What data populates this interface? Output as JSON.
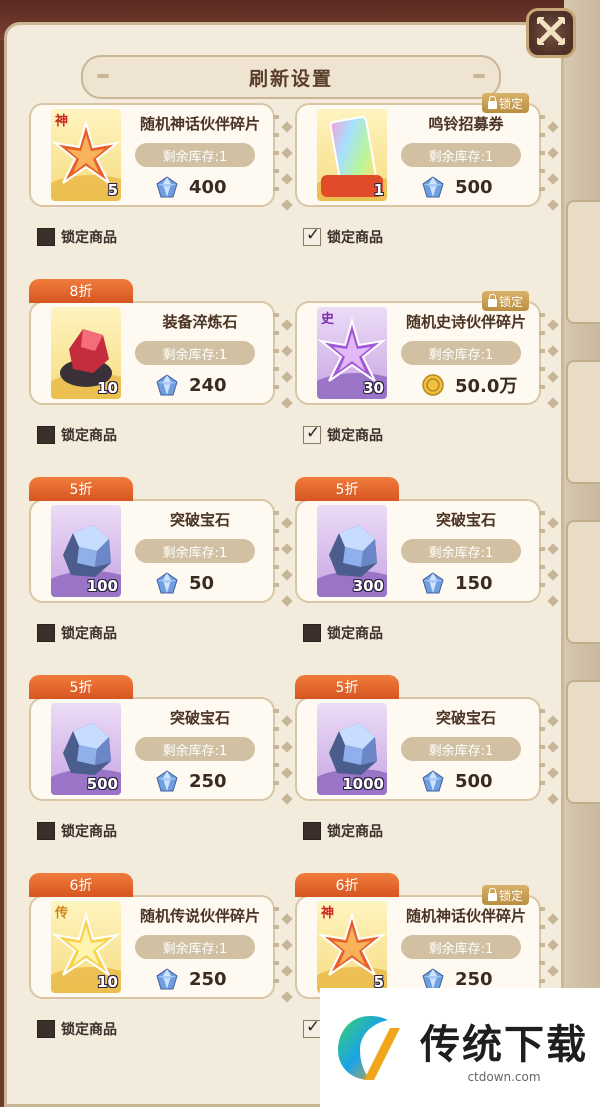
{
  "dialog": {
    "title": "刷新设置"
  },
  "lock_label": "锁定商品",
  "lock_tag": "锁定",
  "stock_prefix": "剩余库存:",
  "cards": [
    {
      "name": "随机神话伙伴碎片",
      "count": "5",
      "stock": "剩余库存:1",
      "price": "400",
      "currency": "gem",
      "discount": "",
      "locked_tag": false,
      "locked": false,
      "art": "mythic-star-shard",
      "frame": "gold"
    },
    {
      "name": "鸣铃招募券",
      "count": "1",
      "stock": "剩余库存:1",
      "price": "500",
      "currency": "gem",
      "discount": "",
      "locked_tag": true,
      "locked": true,
      "art": "rainbow-ticket",
      "frame": "gold"
    },
    {
      "name": "装备淬炼石",
      "count": "10",
      "stock": "剩余库存:1",
      "price": "240",
      "currency": "gem",
      "discount": "8折",
      "locked_tag": false,
      "locked": false,
      "art": "red-ore",
      "frame": "gold"
    },
    {
      "name": "随机史诗伙伴碎片",
      "count": "30",
      "stock": "剩余库存:1",
      "price": "50.0万",
      "currency": "coin",
      "discount": "",
      "locked_tag": true,
      "locked": true,
      "art": "epic-star-shard",
      "frame": "purple"
    },
    {
      "name": "突破宝石",
      "count": "100",
      "stock": "剩余库存:1",
      "price": "50",
      "currency": "gem",
      "discount": "5折",
      "locked_tag": false,
      "locked": false,
      "art": "breakthrough-gem",
      "frame": "purple"
    },
    {
      "name": "突破宝石",
      "count": "300",
      "stock": "剩余库存:1",
      "price": "150",
      "currency": "gem",
      "discount": "5折",
      "locked_tag": false,
      "locked": false,
      "art": "breakthrough-gem",
      "frame": "purple"
    },
    {
      "name": "突破宝石",
      "count": "500",
      "stock": "剩余库存:1",
      "price": "250",
      "currency": "gem",
      "discount": "5折",
      "locked_tag": false,
      "locked": false,
      "art": "breakthrough-gem",
      "frame": "purple"
    },
    {
      "name": "突破宝石",
      "count": "1000",
      "stock": "剩余库存:1",
      "price": "500",
      "currency": "gem",
      "discount": "5折",
      "locked_tag": false,
      "locked": false,
      "art": "breakthrough-gem",
      "frame": "purple"
    },
    {
      "name": "随机传说伙伴碎片",
      "count": "10",
      "stock": "剩余库存:1",
      "price": "250",
      "currency": "gem",
      "discount": "6折",
      "locked_tag": false,
      "locked": false,
      "art": "legend-star-shard",
      "frame": "gold"
    },
    {
      "name": "随机神话伙伴碎片",
      "count": "5",
      "stock": "剩余库存:1",
      "price": "250",
      "currency": "gem",
      "discount": "6折",
      "locked_tag": true,
      "locked": true,
      "art": "mythic-star-shard",
      "frame": "gold"
    }
  ],
  "watermark": {
    "title": "传统下载",
    "url": "ctdown.com"
  },
  "colors": {
    "discount": "#e0642a",
    "accent_gold": "#c9a25a",
    "panel": "#f3ebdc"
  }
}
